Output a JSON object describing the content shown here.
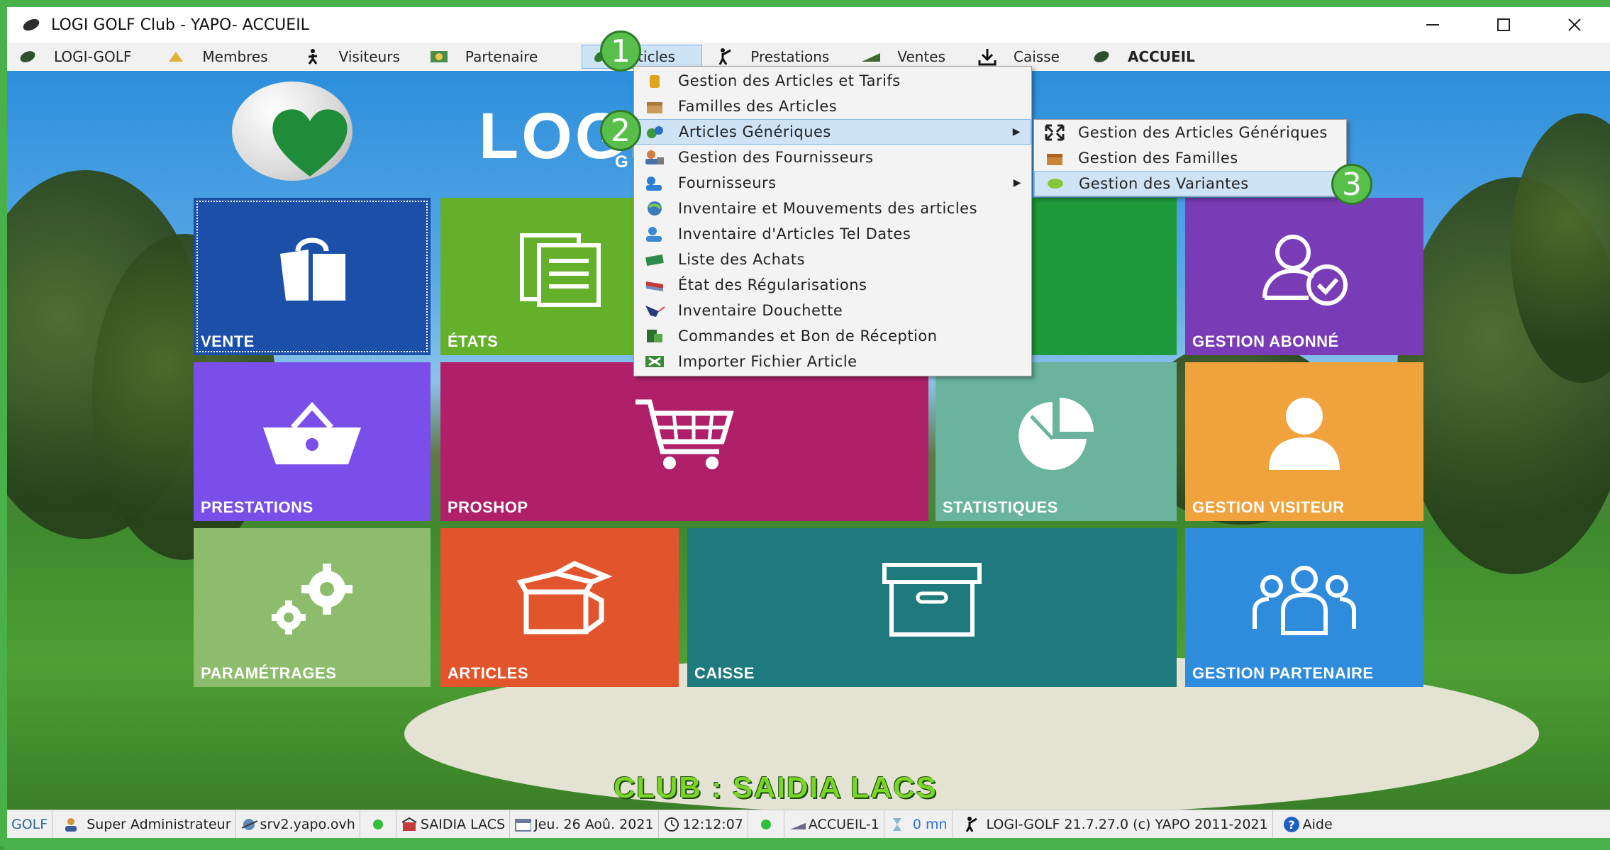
{
  "window": {
    "title": "LOGI GOLF Club - YAPO- ACCUEIL"
  },
  "menubar": {
    "items": [
      {
        "label": "LOGI-GOLF",
        "icon": "golf-ball-icon"
      },
      {
        "label": "Membres",
        "icon": "members-icon"
      },
      {
        "label": "Visiteurs",
        "icon": "walker-icon"
      },
      {
        "label": "Partenaire",
        "icon": "partner-icon"
      },
      {
        "label": "Articles",
        "icon": "articles-icon"
      },
      {
        "label": "Prestations",
        "icon": "golfer-icon"
      },
      {
        "label": "Ventes",
        "icon": "sales-icon"
      },
      {
        "label": "Caisse",
        "icon": "download-icon"
      },
      {
        "label": "ACCUEIL",
        "icon": "home-icon"
      }
    ]
  },
  "logo": {
    "text": "LOGI",
    "sub": "G"
  },
  "articles_menu": {
    "items": [
      {
        "label": "Gestion des Articles et Tarifs"
      },
      {
        "label": "Familles des Articles"
      },
      {
        "label": "Articles Génériques"
      },
      {
        "label": "Gestion des Fournisseurs"
      },
      {
        "label": "Fournisseurs"
      },
      {
        "label": "Inventaire et Mouvements des articles"
      },
      {
        "label": "Inventaire d'Articles Tel Dates"
      },
      {
        "label": "Liste des Achats"
      },
      {
        "label": "État des Régularisations"
      },
      {
        "label": "Inventaire Douchette"
      },
      {
        "label": "Commandes et Bon de Réception"
      },
      {
        "label": "Importer Fichier Article"
      }
    ]
  },
  "generic_submenu": {
    "items": [
      {
        "label": "Gestion des Articles Génériques"
      },
      {
        "label": "Gestion des Familles"
      },
      {
        "label": "Gestion des Variantes"
      }
    ]
  },
  "badges": [
    "1",
    "2",
    "3"
  ],
  "tiles": {
    "vente": "VENTE",
    "etats": "ÉTATS",
    "gestion_abonne": "GESTION ABONNÉ",
    "prestations": "PRESTATIONS",
    "proshop": "PROSHOP",
    "statistiques": "STATISTIQUES",
    "gestion_visiteur": "GESTION VISITEUR",
    "parametrages": "PARAMÉTRAGES",
    "articles": "ARTICLES",
    "caisse": "CAISSE",
    "gestion_partenaire": "GESTION PARTENAIRE"
  },
  "club": "CLUB : SAIDIA LACS",
  "statusbar": {
    "app": "GOLF",
    "user": "Super Administrateur",
    "server": "srv2.yapo.ovh",
    "site": "SAIDIA LACS",
    "date": "Jeu. 26 Aoû. 2021",
    "time": "12:12:07",
    "station": "ACCUEIL-1",
    "idle": "0 mn",
    "version": "LOGI-GOLF 21.7.27.0 (c) YAPO 2011-2021",
    "help": "Aide"
  },
  "colors": {
    "vente": "#1c4fa8",
    "etats": "#64b02a",
    "green_block": "#1f9a3a",
    "gestion_abonne": "#7a3bb6",
    "prestations": "#7a4ee8",
    "proshop": "#b0206a",
    "statistiques": "#6ab39c",
    "gestion_visiteur": "#f0a33c",
    "parametrages": "#8dbd6c",
    "articles": "#e2552c",
    "caisse": "#1e7a7c",
    "gestion_partenaire": "#2f8cdc"
  }
}
